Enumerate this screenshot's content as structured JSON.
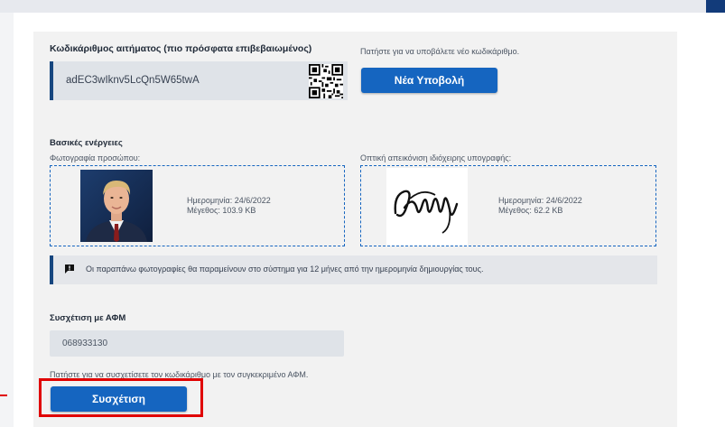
{
  "request_code": {
    "label": "Κωδικάριθμος αιτήματος (πιο πρόσφατα επιβεβαιωμένος)",
    "value": "adEC3wIknv5LcQn5W65twA"
  },
  "new_submission": {
    "hint": "Πατήστε για να υποβάλετε νέο κωδικάριθμο.",
    "button_label": "Νέα Υποβολή"
  },
  "basic_actions": {
    "heading": "Βασικές ενέργειες",
    "photo": {
      "label": "Φωτογραφία προσώπου:",
      "date": "Ημερομηνία: 24/6/2022",
      "size": "Μέγεθος: 103.9 KB"
    },
    "signature": {
      "label": "Οπτική απεικόνιση ιδιόχειρης υπογραφής:",
      "date": "Ημερομηνία: 24/6/2022",
      "size": "Μέγεθος: 62.2 KB"
    }
  },
  "notice": {
    "icon": "comment-alert-icon",
    "text": "Οι παραπάνω φωτογραφίες θα παραμείνουν στο σύστημα για 12 μήνες από την ημερομηνία δημιουργίας τους."
  },
  "afm": {
    "heading": "Συσχέτιση με ΑΦΜ",
    "value": "068933130",
    "hint": "Πατήστε για να συσχετίσετε τον κωδικάριθμο με τον συγκεκριμένο ΑΦΜ.",
    "button_label": "Συσχέτιση"
  },
  "colors": {
    "primary": "#1565c0",
    "accent_border": "#16467f",
    "highlight": "#e00000"
  }
}
